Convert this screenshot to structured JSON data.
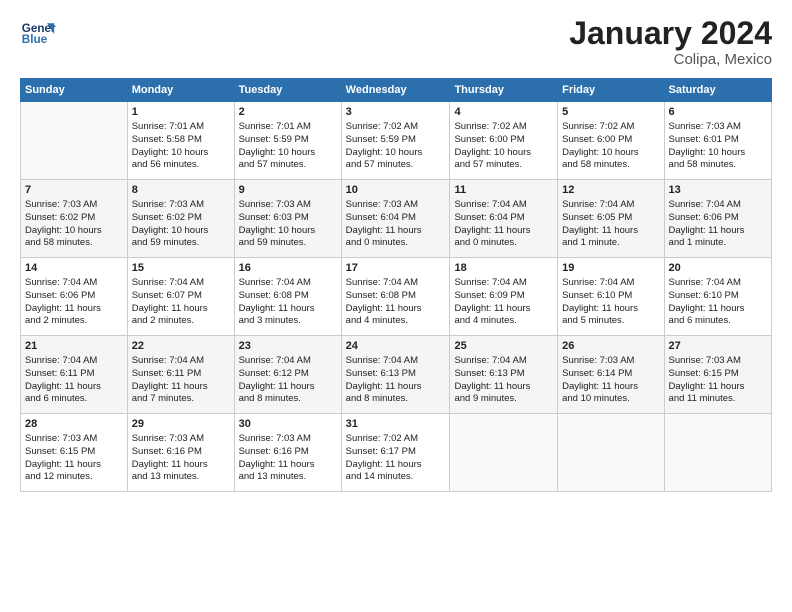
{
  "logo": {
    "line1": "General",
    "line2": "Blue"
  },
  "title": "January 2024",
  "subtitle": "Colipa, Mexico",
  "headers": [
    "Sunday",
    "Monday",
    "Tuesday",
    "Wednesday",
    "Thursday",
    "Friday",
    "Saturday"
  ],
  "weeks": [
    [
      {
        "day": "",
        "data": ""
      },
      {
        "day": "1",
        "data": "Sunrise: 7:01 AM\nSunset: 5:58 PM\nDaylight: 10 hours\nand 56 minutes."
      },
      {
        "day": "2",
        "data": "Sunrise: 7:01 AM\nSunset: 5:59 PM\nDaylight: 10 hours\nand 57 minutes."
      },
      {
        "day": "3",
        "data": "Sunrise: 7:02 AM\nSunset: 5:59 PM\nDaylight: 10 hours\nand 57 minutes."
      },
      {
        "day": "4",
        "data": "Sunrise: 7:02 AM\nSunset: 6:00 PM\nDaylight: 10 hours\nand 57 minutes."
      },
      {
        "day": "5",
        "data": "Sunrise: 7:02 AM\nSunset: 6:00 PM\nDaylight: 10 hours\nand 58 minutes."
      },
      {
        "day": "6",
        "data": "Sunrise: 7:03 AM\nSunset: 6:01 PM\nDaylight: 10 hours\nand 58 minutes."
      }
    ],
    [
      {
        "day": "7",
        "data": "Sunrise: 7:03 AM\nSunset: 6:02 PM\nDaylight: 10 hours\nand 58 minutes."
      },
      {
        "day": "8",
        "data": "Sunrise: 7:03 AM\nSunset: 6:02 PM\nDaylight: 10 hours\nand 59 minutes."
      },
      {
        "day": "9",
        "data": "Sunrise: 7:03 AM\nSunset: 6:03 PM\nDaylight: 10 hours\nand 59 minutes."
      },
      {
        "day": "10",
        "data": "Sunrise: 7:03 AM\nSunset: 6:04 PM\nDaylight: 11 hours\nand 0 minutes."
      },
      {
        "day": "11",
        "data": "Sunrise: 7:04 AM\nSunset: 6:04 PM\nDaylight: 11 hours\nand 0 minutes."
      },
      {
        "day": "12",
        "data": "Sunrise: 7:04 AM\nSunset: 6:05 PM\nDaylight: 11 hours\nand 1 minute."
      },
      {
        "day": "13",
        "data": "Sunrise: 7:04 AM\nSunset: 6:06 PM\nDaylight: 11 hours\nand 1 minute."
      }
    ],
    [
      {
        "day": "14",
        "data": "Sunrise: 7:04 AM\nSunset: 6:06 PM\nDaylight: 11 hours\nand 2 minutes."
      },
      {
        "day": "15",
        "data": "Sunrise: 7:04 AM\nSunset: 6:07 PM\nDaylight: 11 hours\nand 2 minutes."
      },
      {
        "day": "16",
        "data": "Sunrise: 7:04 AM\nSunset: 6:08 PM\nDaylight: 11 hours\nand 3 minutes."
      },
      {
        "day": "17",
        "data": "Sunrise: 7:04 AM\nSunset: 6:08 PM\nDaylight: 11 hours\nand 4 minutes."
      },
      {
        "day": "18",
        "data": "Sunrise: 7:04 AM\nSunset: 6:09 PM\nDaylight: 11 hours\nand 4 minutes."
      },
      {
        "day": "19",
        "data": "Sunrise: 7:04 AM\nSunset: 6:10 PM\nDaylight: 11 hours\nand 5 minutes."
      },
      {
        "day": "20",
        "data": "Sunrise: 7:04 AM\nSunset: 6:10 PM\nDaylight: 11 hours\nand 6 minutes."
      }
    ],
    [
      {
        "day": "21",
        "data": "Sunrise: 7:04 AM\nSunset: 6:11 PM\nDaylight: 11 hours\nand 6 minutes."
      },
      {
        "day": "22",
        "data": "Sunrise: 7:04 AM\nSunset: 6:11 PM\nDaylight: 11 hours\nand 7 minutes."
      },
      {
        "day": "23",
        "data": "Sunrise: 7:04 AM\nSunset: 6:12 PM\nDaylight: 11 hours\nand 8 minutes."
      },
      {
        "day": "24",
        "data": "Sunrise: 7:04 AM\nSunset: 6:13 PM\nDaylight: 11 hours\nand 8 minutes."
      },
      {
        "day": "25",
        "data": "Sunrise: 7:04 AM\nSunset: 6:13 PM\nDaylight: 11 hours\nand 9 minutes."
      },
      {
        "day": "26",
        "data": "Sunrise: 7:03 AM\nSunset: 6:14 PM\nDaylight: 11 hours\nand 10 minutes."
      },
      {
        "day": "27",
        "data": "Sunrise: 7:03 AM\nSunset: 6:15 PM\nDaylight: 11 hours\nand 11 minutes."
      }
    ],
    [
      {
        "day": "28",
        "data": "Sunrise: 7:03 AM\nSunset: 6:15 PM\nDaylight: 11 hours\nand 12 minutes."
      },
      {
        "day": "29",
        "data": "Sunrise: 7:03 AM\nSunset: 6:16 PM\nDaylight: 11 hours\nand 13 minutes."
      },
      {
        "day": "30",
        "data": "Sunrise: 7:03 AM\nSunset: 6:16 PM\nDaylight: 11 hours\nand 13 minutes."
      },
      {
        "day": "31",
        "data": "Sunrise: 7:02 AM\nSunset: 6:17 PM\nDaylight: 11 hours\nand 14 minutes."
      },
      {
        "day": "",
        "data": ""
      },
      {
        "day": "",
        "data": ""
      },
      {
        "day": "",
        "data": ""
      }
    ]
  ]
}
